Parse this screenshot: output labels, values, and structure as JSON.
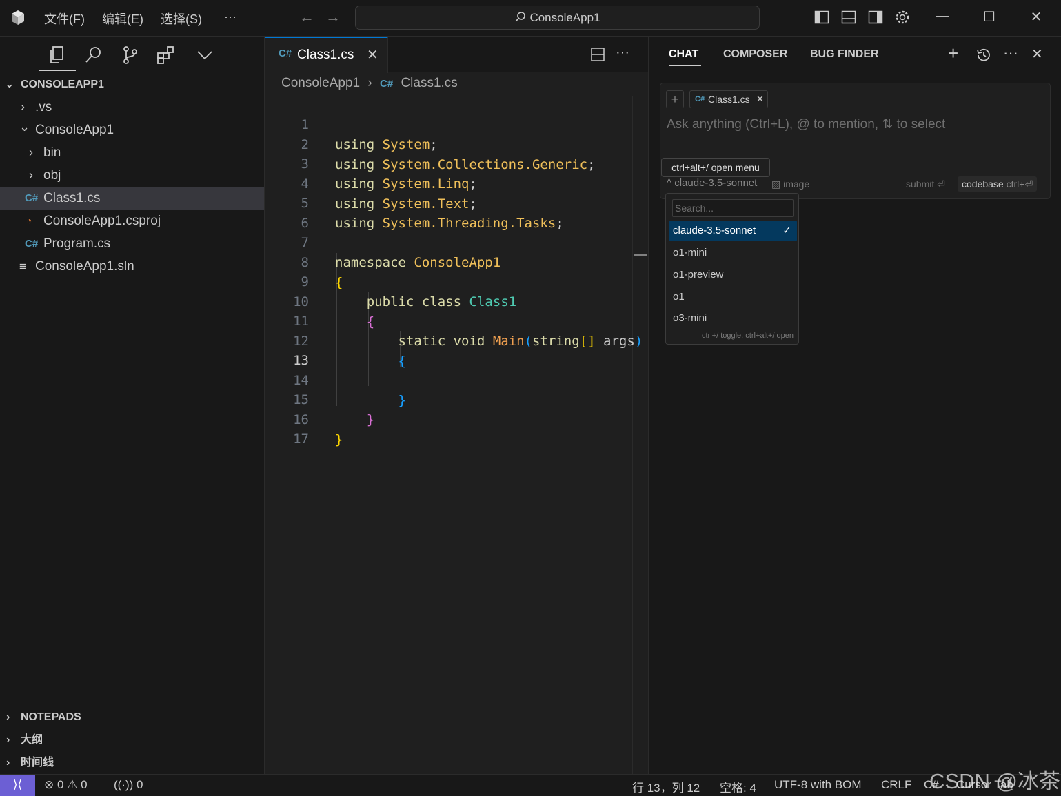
{
  "menu": {
    "file": "文件(F)",
    "edit": "编辑(E)",
    "selection": "选择(S)",
    "more": "···"
  },
  "command_center": {
    "text": "ConsoleApp1"
  },
  "explorer": {
    "root": "CONSOLEAPP1",
    "items": [
      {
        "label": ".vs",
        "chevron": "›"
      },
      {
        "label": "ConsoleApp1",
        "chevron": "⌄"
      },
      {
        "label": "bin",
        "chevron": "›"
      },
      {
        "label": "obj",
        "chevron": "›"
      },
      {
        "label": "Class1.cs",
        "icon": "C#"
      },
      {
        "label": "ConsoleApp1.csproj",
        "icon": "rss"
      },
      {
        "label": "Program.cs",
        "icon": "C#"
      },
      {
        "label": "ConsoleApp1.sln",
        "icon": "≡"
      }
    ],
    "sections": [
      "NOTEPADS",
      "大纲",
      "时间线"
    ]
  },
  "editor": {
    "tab_label": "Class1.cs",
    "breadcrumb": [
      "ConsoleApp1",
      "Class1.cs"
    ],
    "line_numbers": [
      "1",
      "2",
      "3",
      "4",
      "5",
      "6",
      "7",
      "8",
      "9",
      "10",
      "11",
      "12",
      "13",
      "14",
      "15",
      "16",
      "17"
    ],
    "active_line": "13"
  },
  "chat": {
    "tabs": [
      "CHAT",
      "COMPOSER",
      "BUG FINDER"
    ],
    "context_chip": "Class1.cs",
    "placeholder": "Ask anything (Ctrl+L), @ to mention, ⇅ to select",
    "tooltip": "ctrl+alt+/ open menu",
    "model_selected": "claude-3.5-sonnet",
    "image_label": "image",
    "submit_label": "submit ⏎",
    "codebase_label": "codebase",
    "codebase_kbd": "ctrl+⏎",
    "dropdown": {
      "search_placeholder": "Search...",
      "options": [
        "claude-3.5-sonnet",
        "o1-mini",
        "o1-preview",
        "o1",
        "o3-mini"
      ],
      "selected_index": 0,
      "hint": "ctrl+/ toggle, ctrl+alt+/ open"
    }
  },
  "statusbar": {
    "errors": "0",
    "warnings": "0",
    "ports": "0",
    "position": "行 13，列 12",
    "spaces": "空格: 4",
    "encoding": "UTF-8 with BOM",
    "eol": "CRLF",
    "language": "C#",
    "extra": "Cursor Tab"
  },
  "watermark": "CSDN @冰茶",
  "colors": {
    "accent": "#0078d4",
    "remote": "#6c5fd4",
    "selection": "#04395e"
  }
}
